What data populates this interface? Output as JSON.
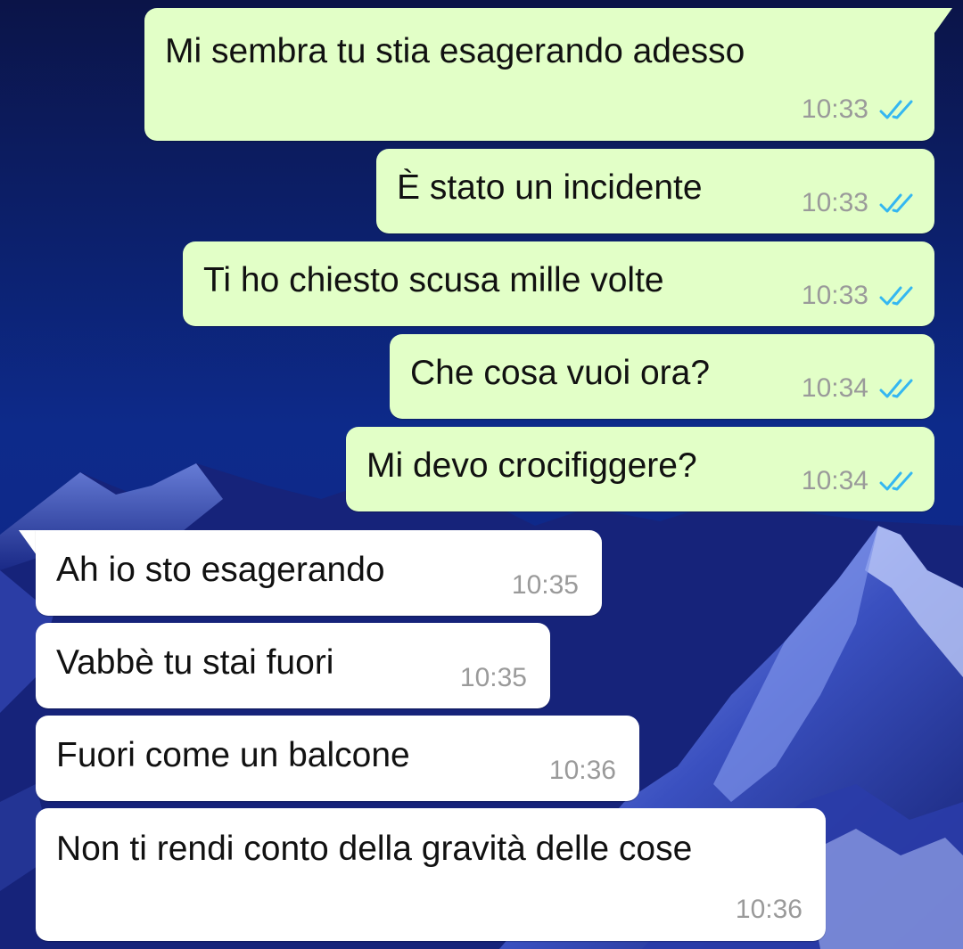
{
  "colors": {
    "outgoing_bubble": "#e2ffc7",
    "incoming_bubble": "#ffffff",
    "read_ticks": "#34b7f1",
    "timestamp": "#9a9a9a",
    "wallpaper_sky": "#0a1a5c"
  },
  "messages": [
    {
      "direction": "outgoing",
      "text": "Mi sembra tu stia esagerando adesso",
      "time": "10:33",
      "status_icon": "double-check-read-icon"
    },
    {
      "direction": "outgoing",
      "text": "È stato un incidente",
      "time": "10:33",
      "status_icon": "double-check-read-icon"
    },
    {
      "direction": "outgoing",
      "text": "Ti ho chiesto scusa mille volte",
      "time": "10:33",
      "status_icon": "double-check-read-icon"
    },
    {
      "direction": "outgoing",
      "text": "Che cosa vuoi ora?",
      "time": "10:34",
      "status_icon": "double-check-read-icon"
    },
    {
      "direction": "outgoing",
      "text": "Mi devo crocifiggere?",
      "time": "10:34",
      "status_icon": "double-check-read-icon"
    },
    {
      "direction": "incoming",
      "text": "Ah io sto esagerando",
      "time": "10:35"
    },
    {
      "direction": "incoming",
      "text": "Vabbè tu stai fuori",
      "time": "10:35"
    },
    {
      "direction": "incoming",
      "text": "Fuori come un balcone",
      "time": "10:36"
    },
    {
      "direction": "incoming",
      "text": "Non ti rendi conto della gravità delle cose",
      "time": "10:36"
    }
  ]
}
